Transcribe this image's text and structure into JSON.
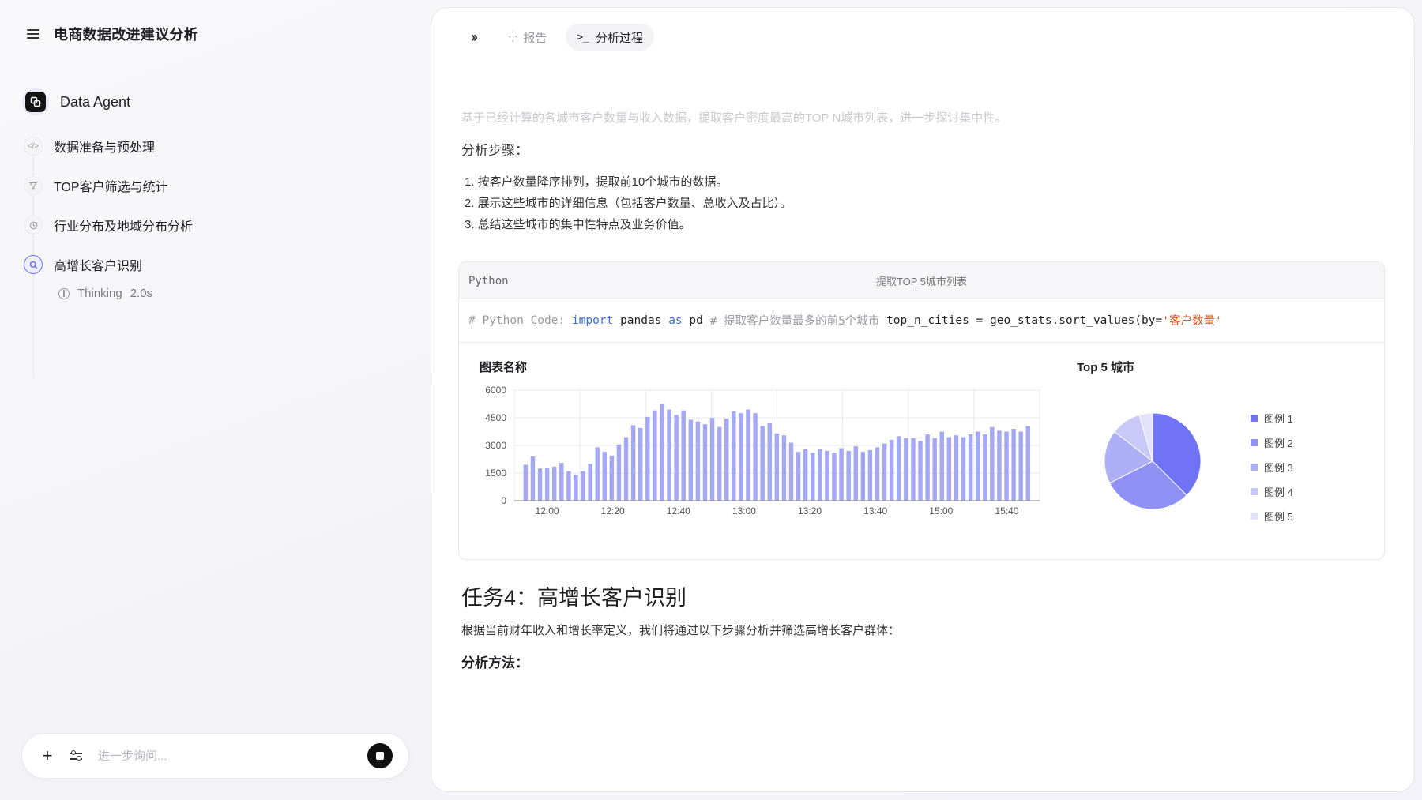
{
  "sidebar": {
    "title": "电商数据改进建议分析",
    "agent_name": "Data Agent",
    "steps": [
      {
        "label": "数据准备与预处理",
        "icon": "code-icon"
      },
      {
        "label": "TOP客户筛选与统计",
        "icon": "filter-icon"
      },
      {
        "label": "行业分布及地域分布分析",
        "icon": "clock-icon"
      },
      {
        "label": "高增长客户识别",
        "icon": "search-icon"
      }
    ],
    "thinking_label": "Thinking",
    "thinking_time": "2.0s",
    "chat_placeholder": "进一步询问..."
  },
  "tabs": [
    {
      "label": "报告",
      "icon": "loading-icon",
      "active": false
    },
    {
      "label": "分析过程",
      "icon": "terminal-icon",
      "active": true
    }
  ],
  "content": {
    "faded_line": "基于已经计算的各城市客户数量与收入数据，提取客户密度最高的TOP N城市列表，进一步探讨集中性。",
    "steps_heading": "分析步骤：",
    "steps_list": [
      "1. 按客户数量降序排列，提取前10个城市的数据。",
      "2. 展示这些城市的详细信息（包括客户数量、总收入及占比）。",
      "3. 总结这些城市的集中性特点及业务价值。"
    ],
    "code": {
      "lang": "Python",
      "title": "提取TOP 5城市列表",
      "comment1": "# Python Code:",
      "kw_import": "import",
      "module": "pandas",
      "kw_as": "as",
      "alias": "pd",
      "comment2": "# 提取客户数量最多的前5个城市",
      "stmt": "top_n_cities = geo_stats.sort_values(by=",
      "str_arg": "'客户数量'"
    },
    "task_heading": "任务4：高增长客户识别",
    "task_para": "根据当前财年收入和增长率定义，我们将通过以下步骤分析并筛选高增长客户群体：",
    "task_method": "分析方法："
  },
  "chart_data": [
    {
      "type": "bar",
      "title": "图表名称",
      "ylim": [
        0,
        6000
      ],
      "yticks": [
        "0",
        "1500",
        "3000",
        "4500",
        "6000"
      ],
      "xtick_labels": [
        "12:00",
        "12:20",
        "12:40",
        "13:00",
        "13:20",
        "13:40",
        "15:00",
        "15:40"
      ],
      "grid": true,
      "color": "#a5a8f3",
      "values": [
        1950,
        2400,
        1750,
        1800,
        1850,
        2050,
        1600,
        1400,
        1600,
        2000,
        2900,
        2650,
        2450,
        3050,
        3450,
        4100,
        3950,
        4550,
        4900,
        5250,
        4950,
        4650,
        4900,
        4400,
        4300,
        4150,
        4500,
        4000,
        4450,
        4850,
        4750,
        4950,
        4750,
        4050,
        4200,
        3650,
        3550,
        3150,
        2650,
        2800,
        2600,
        2800,
        2700,
        2600,
        2850,
        2700,
        2950,
        2650,
        2750,
        2900,
        3100,
        3300,
        3500,
        3400,
        3400,
        3250,
        3600,
        3400,
        3750,
        3450,
        3550,
        3450,
        3600,
        3750,
        3600,
        4000,
        3800,
        3750,
        3900,
        3750,
        4050
      ]
    },
    {
      "type": "pie",
      "title": "Top 5 城市",
      "legend_position": "right",
      "categories": [
        "图例 1",
        "图例 2",
        "图例 3",
        "图例 4",
        "图例 5"
      ],
      "values": [
        37.5,
        30,
        18,
        10,
        4.5
      ],
      "colors": [
        "#7073f5",
        "#8f92f4",
        "#aeb0f6",
        "#c8c9f8",
        "#e2e2fb"
      ]
    }
  ]
}
